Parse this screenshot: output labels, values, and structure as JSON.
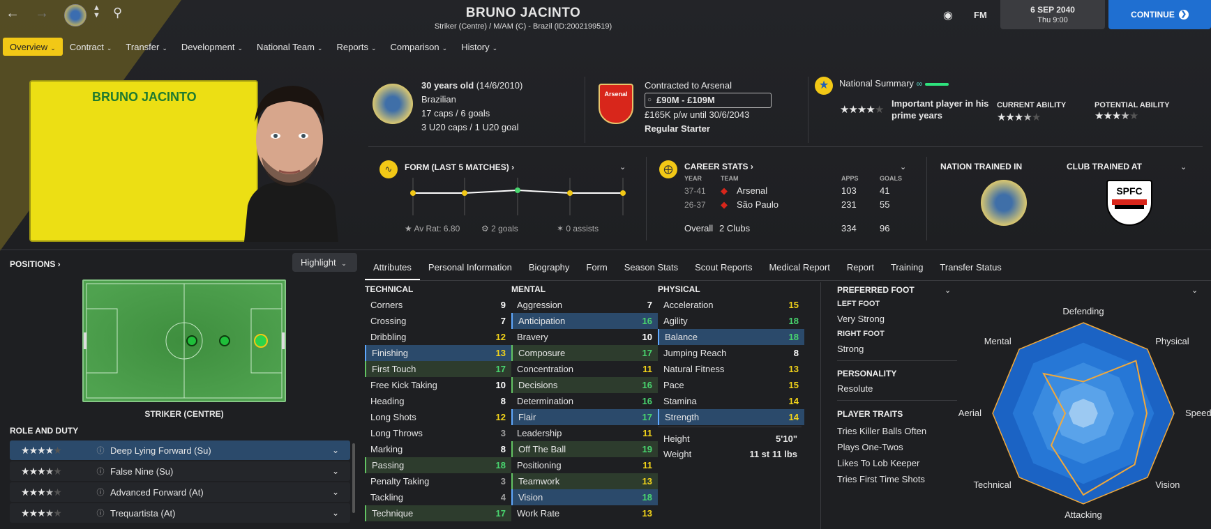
{
  "header": {
    "player_name": "BRUNO JACINTO",
    "subtitle": "Striker (Centre) / M/AM (C) - Brazil (ID:2002199519)",
    "date": "6 SEP 2040",
    "time": "Thu 9:00",
    "fm_label": "FM",
    "continue_label": "CONTINUE"
  },
  "menu": [
    {
      "label": "Overview"
    },
    {
      "label": "Contract"
    },
    {
      "label": "Transfer"
    },
    {
      "label": "Development"
    },
    {
      "label": "National Team"
    },
    {
      "label": "Reports"
    },
    {
      "label": "Comparison"
    },
    {
      "label": "History"
    }
  ],
  "card": {
    "name": "BRUNO JACINTO"
  },
  "bio": {
    "age": "30 years old",
    "dob": "(14/6/2010)",
    "nationality": "Brazilian",
    "caps": "17 caps / 6 goals",
    "u20": "3 U20 caps / 1 U20 goal"
  },
  "contract": {
    "club_line": "Contracted to Arsenal",
    "value": "£90M - £109M",
    "wage": "£165K p/w until 30/6/2043",
    "status": "Regular Starter",
    "crest_text": "Arsenal"
  },
  "national": {
    "title": "National Summary",
    "summary": "Important player in his prime years",
    "current_ability_label": "CURRENT ABILITY",
    "potential_ability_label": "POTENTIAL ABILITY",
    "summary_stars": 4,
    "current_stars": 3.5,
    "potential_stars": 3.5
  },
  "form": {
    "title": "FORM (LAST 5 MATCHES)",
    "av_rat": "Av Rat: 6.80",
    "goals": "2 goals",
    "assists": "0 assists",
    "points": [
      6.8,
      6.8,
      6.9,
      6.8,
      6.8
    ]
  },
  "career": {
    "title": "CAREER STATS",
    "headers": {
      "year": "YEAR",
      "team": "TEAM",
      "apps": "APPS",
      "goals": "GOALS"
    },
    "rows": [
      {
        "year": "37-41",
        "team": "Arsenal",
        "apps": "103",
        "goals": "41"
      },
      {
        "year": "26-37",
        "team": "São Paulo",
        "apps": "231",
        "goals": "55"
      }
    ],
    "overall_label": "Overall",
    "overall_clubs": "2 Clubs",
    "overall_apps": "334",
    "overall_goals": "96"
  },
  "trained": {
    "nation_label": "NATION TRAINED IN",
    "club_label": "CLUB TRAINED AT",
    "club_crest_text": "SPFC"
  },
  "positions": {
    "title": "POSITIONS",
    "highlight_label": "Highlight",
    "position_name": "STRIKER (CENTRE)"
  },
  "roles": {
    "title": "ROLE AND DUTY",
    "items": [
      {
        "label": "Deep Lying Forward (Su)",
        "stars": 4
      },
      {
        "label": "False Nine (Su)",
        "stars": 3.5
      },
      {
        "label": "Advanced Forward (At)",
        "stars": 3.5
      },
      {
        "label": "Trequartista (At)",
        "stars": 3.5
      }
    ]
  },
  "tabs": [
    "Attributes",
    "Personal Information",
    "Biography",
    "Form",
    "Season Stats",
    "Scout Reports",
    "Medical Report",
    "Report",
    "Training",
    "Transfer Status"
  ],
  "technical": {
    "title": "TECHNICAL",
    "rows": [
      {
        "name": "Corners",
        "value": "9"
      },
      {
        "name": "Crossing",
        "value": "7"
      },
      {
        "name": "Dribbling",
        "value": "12"
      },
      {
        "name": "Finishing",
        "value": "13"
      },
      {
        "name": "First Touch",
        "value": "17"
      },
      {
        "name": "Free Kick Taking",
        "value": "10"
      },
      {
        "name": "Heading",
        "value": "8"
      },
      {
        "name": "Long Shots",
        "value": "12"
      },
      {
        "name": "Long Throws",
        "value": "3"
      },
      {
        "name": "Marking",
        "value": "8"
      },
      {
        "name": "Passing",
        "value": "18"
      },
      {
        "name": "Penalty Taking",
        "value": "3"
      },
      {
        "name": "Tackling",
        "value": "4"
      },
      {
        "name": "Technique",
        "value": "17"
      }
    ]
  },
  "mental": {
    "title": "MENTAL",
    "rows": [
      {
        "name": "Aggression",
        "value": "7"
      },
      {
        "name": "Anticipation",
        "value": "16"
      },
      {
        "name": "Bravery",
        "value": "10"
      },
      {
        "name": "Composure",
        "value": "17"
      },
      {
        "name": "Concentration",
        "value": "11"
      },
      {
        "name": "Decisions",
        "value": "16"
      },
      {
        "name": "Determination",
        "value": "16"
      },
      {
        "name": "Flair",
        "value": "17"
      },
      {
        "name": "Leadership",
        "value": "11"
      },
      {
        "name": "Off The Ball",
        "value": "19"
      },
      {
        "name": "Positioning",
        "value": "11"
      },
      {
        "name": "Teamwork",
        "value": "13"
      },
      {
        "name": "Vision",
        "value": "18"
      },
      {
        "name": "Work Rate",
        "value": "13"
      }
    ]
  },
  "physical": {
    "title": "PHYSICAL",
    "rows": [
      {
        "name": "Acceleration",
        "value": "15"
      },
      {
        "name": "Agility",
        "value": "18"
      },
      {
        "name": "Balance",
        "value": "18"
      },
      {
        "name": "Jumping Reach",
        "value": "8"
      },
      {
        "name": "Natural Fitness",
        "value": "13"
      },
      {
        "name": "Pace",
        "value": "15"
      },
      {
        "name": "Stamina",
        "value": "14"
      },
      {
        "name": "Strength",
        "value": "14"
      }
    ],
    "height_label": "Height",
    "height": "5'10\"",
    "weight_label": "Weight",
    "weight": "11 st 11 lbs"
  },
  "foot": {
    "title": "PREFERRED FOOT",
    "left_label": "LEFT FOOT",
    "left": "Very Strong",
    "right_label": "RIGHT FOOT",
    "right": "Strong",
    "personality_label": "PERSONALITY",
    "personality": "Resolute",
    "traits_label": "PLAYER TRAITS",
    "traits": [
      "Tries Killer Balls Often",
      "Plays One-Twos",
      "Likes To Lob Keeper",
      "Tries First Time Shots"
    ]
  },
  "chart_data": {
    "type": "radar",
    "categories": [
      "Defending",
      "Physical",
      "Speed",
      "Vision",
      "Attacking",
      "Technical",
      "Aerial",
      "Mental"
    ],
    "values": [
      0.35,
      0.82,
      0.7,
      0.8,
      0.9,
      0.5,
      0.2,
      0.62
    ],
    "max": 1
  },
  "colors": {
    "accent": "#f2c816",
    "blue": "#1f6fd1",
    "green": "#49d66f",
    "yellow": "#f3d41a"
  }
}
